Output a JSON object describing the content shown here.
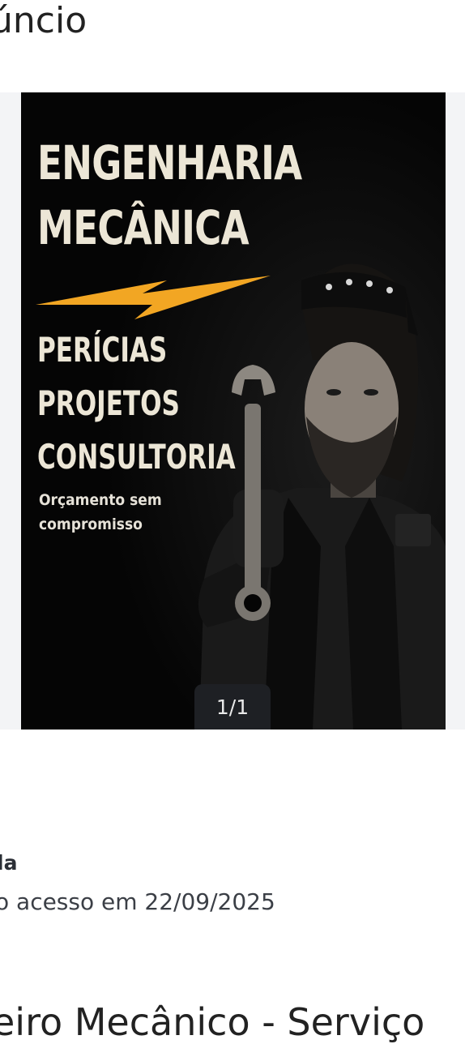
{
  "header": {
    "title_fragment": "úncio"
  },
  "gallery": {
    "counter": "1/1",
    "poster": {
      "headline_line1": "ENGENHARIA",
      "headline_line2": "MECÂNICA",
      "services": [
        "PERÍCIAS",
        "PROJETOS",
        "CONSULTORIA"
      ],
      "note_line1": "Orçamento sem",
      "note_line2": "compromisso",
      "accent_color": "#f2a623"
    }
  },
  "seller": {
    "name_fragment": "la",
    "last_access": "o acesso em 22/09/2025"
  },
  "ad": {
    "title_fragment": "eiro Mecânico - Serviço"
  }
}
